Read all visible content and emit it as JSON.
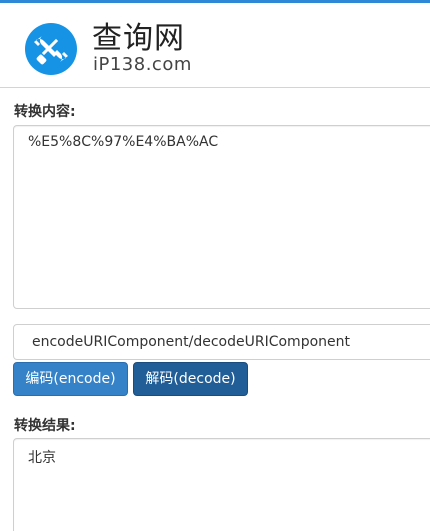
{
  "header": {
    "brand_title": "查询网",
    "brand_subtitle": "iP138.com",
    "logo_icon": "tools-icon",
    "accent_color": "#1793e6"
  },
  "input_section": {
    "label": "转换内容:",
    "value": "%E5%8C%97%E4%BA%AC"
  },
  "method_select": {
    "selected": "encodeURIComponent/decodeURIComponent"
  },
  "buttons": {
    "encode_label": "编码(encode)",
    "decode_label": "解码(decode)",
    "encode_color": "#3582c8",
    "decode_color": "#215d97"
  },
  "result_section": {
    "label": "转换结果:",
    "value": "北京"
  }
}
